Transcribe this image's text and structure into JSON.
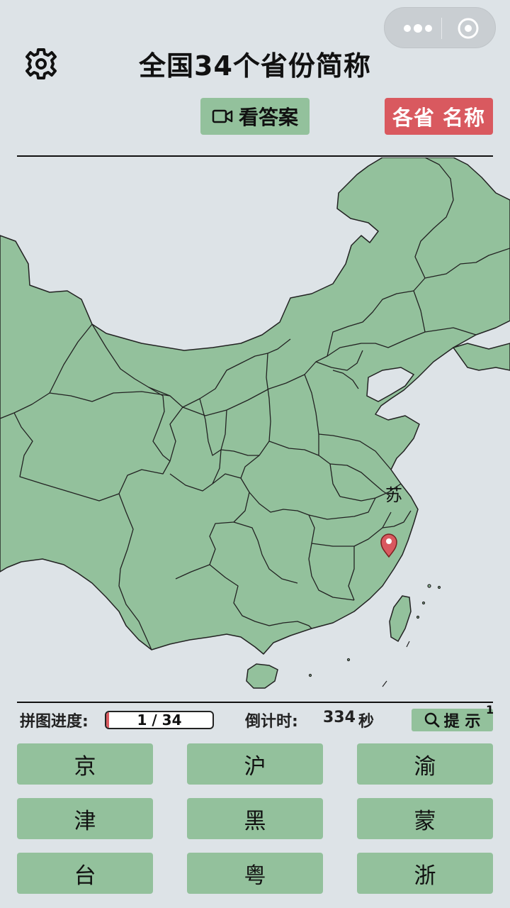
{
  "header": {
    "title": "全国34个省份简称",
    "answer_label": "看答案",
    "names_label": "各省 名称"
  },
  "map": {
    "land_color": "#93c19c",
    "sea_color": "#dde3e7",
    "border_color": "#222222",
    "placed_label": "苏",
    "pin_color": "#d9595f"
  },
  "status": {
    "progress_label": "拼图进度:",
    "progress_text": "1 / 34",
    "progress_value": 1,
    "progress_total": 34,
    "countdown_label": "倒计时:",
    "countdown_value": "334",
    "countdown_unit": "秒",
    "hint_label": "提 示",
    "hint_count": "1"
  },
  "tiles": [
    "京",
    "沪",
    "渝",
    "津",
    "黑",
    "蒙",
    "台",
    "粤",
    "浙"
  ],
  "colors": {
    "accent_green": "#93c19c",
    "accent_red": "#d9595f"
  }
}
